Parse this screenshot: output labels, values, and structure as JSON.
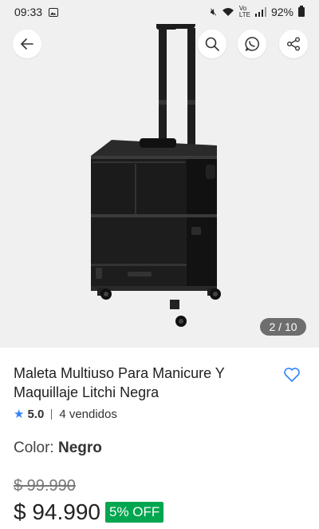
{
  "status_bar": {
    "time": "09:33",
    "icons": [
      "image-icon",
      "mute-icon",
      "wifi-icon",
      "volte-icon",
      "signal-icon",
      "battery-icon"
    ],
    "battery": "92%"
  },
  "gallery": {
    "counter": "2 / 10",
    "background": "#f0f0f0"
  },
  "product": {
    "title": "Maleta Multiuso Para Manicure Y Maquillaje Litchi Negra",
    "rating": "5.0",
    "sold": "4 vendidos",
    "color_label": "Color:",
    "color_value": "Negro",
    "old_price": "$ 99.990",
    "price": "$ 94.990",
    "discount": "5% OFF"
  },
  "colors": {
    "accent": "#3483fa",
    "discount_bg": "#00a650"
  }
}
